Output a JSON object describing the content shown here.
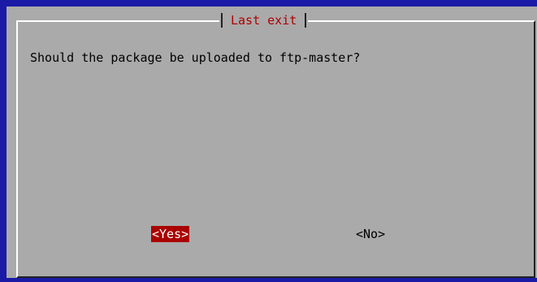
{
  "dialog": {
    "title": "Last exit",
    "question": "Should the package be uploaded to ftp-master?",
    "buttons": {
      "yes_label": "<Yes>",
      "no_label": "<No>",
      "selected": "yes"
    }
  },
  "colors": {
    "screen_background": "#1a1aa6",
    "dialog_background": "#aaaaaa",
    "title_text": "#b00000",
    "selected_button_background": "#aa0000",
    "selected_button_text": "#ffffff"
  }
}
